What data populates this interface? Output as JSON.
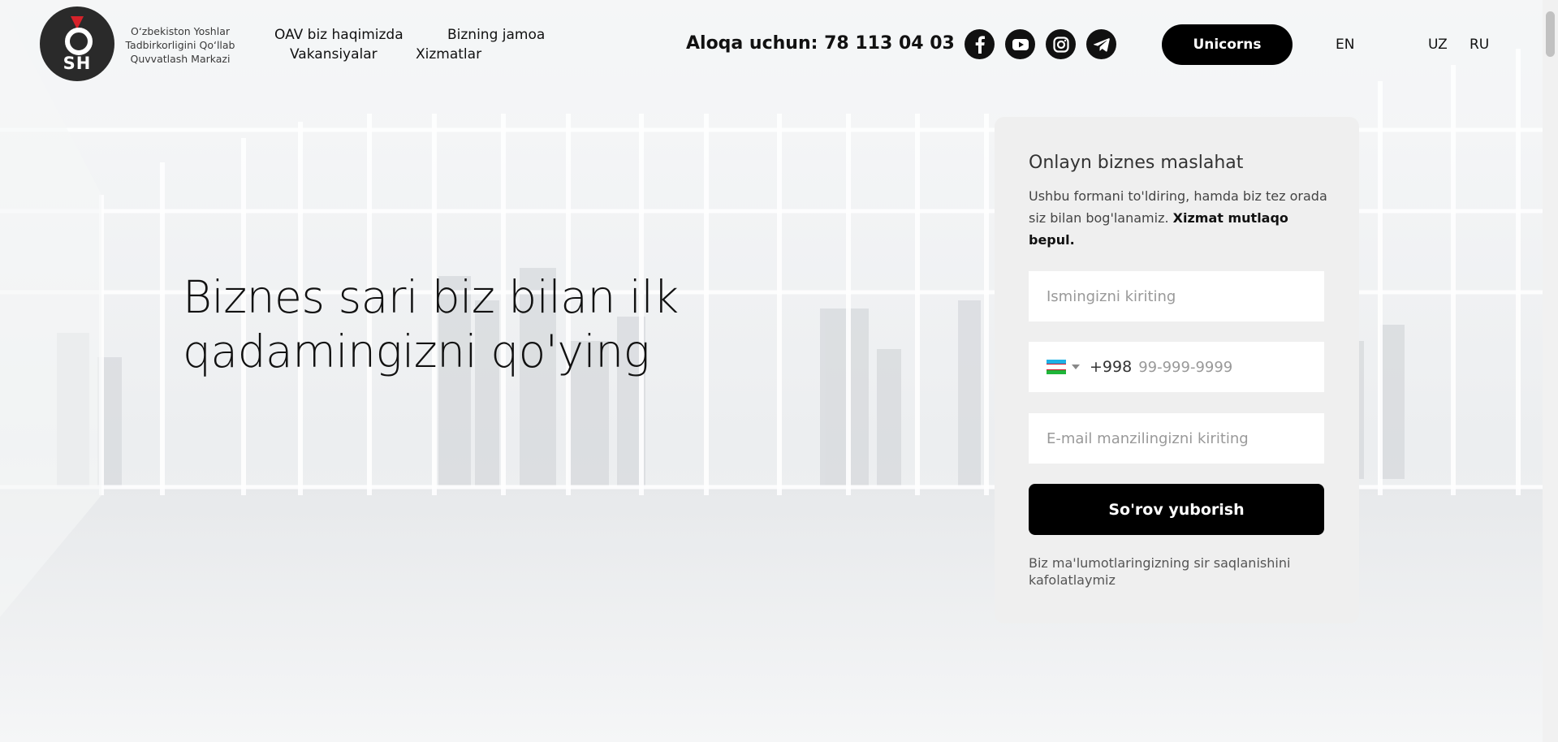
{
  "header": {
    "org_name_lines": [
      "O‘zbekiston Yoshlar",
      "Tadbirkorligini Qo‘llab",
      "Quvvatlash Markazi"
    ],
    "logo_text": "SH",
    "nav": [
      {
        "label": "OAV biz haqimizda"
      },
      {
        "label": "Bizning jamoa"
      },
      {
        "label": "Vakansiyalar"
      },
      {
        "label": "Xizmatlar"
      }
    ],
    "contact": "Aloqa uchun: 78 113 04 03",
    "social": [
      "facebook-icon",
      "youtube-icon",
      "instagram-icon",
      "telegram-icon"
    ],
    "unicorns_label": "Unicorns",
    "languages": [
      "EN",
      "UZ",
      "RU"
    ]
  },
  "hero": {
    "line1": "Biznes sari biz bilan ilk",
    "line2": "qadamingizni qo'ying"
  },
  "form": {
    "title": "Onlayn biznes maslahat",
    "description": "Ushbu formani to'ldiring, hamda biz tez orada siz bilan bog'lanamiz.",
    "description_bold": "Xizmat mutlaqo bepul.",
    "name_placeholder": "Ismingizni kiriting",
    "phone_code": "+998",
    "phone_placeholder": "99-999-9999",
    "email_placeholder": "E-mail manzilingizni kiriting",
    "submit_label": "So'rov yuborish",
    "privacy_note": "Biz ma'lumotlaringizning sir saqlanishini kafolatlaymiz"
  },
  "colors": {
    "primary": "#000000",
    "card_bg": "#efefef",
    "logo_red": "#d6222a",
    "flag_blue": "#1eb1e5",
    "flag_green": "#1eb53a"
  }
}
